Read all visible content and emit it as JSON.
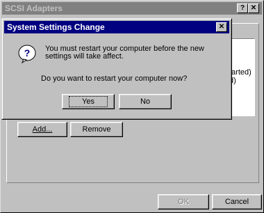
{
  "window": {
    "title": "SCSI Adapters",
    "help_glyph": "?",
    "close_glyph": "✕"
  },
  "list": {
    "partial_line_1": "tarted)",
    "partial_line_2": "d)"
  },
  "buttons": {
    "add": "Add...",
    "remove": "Remove",
    "ok": "OK",
    "cancel": "Cancel"
  },
  "dialog": {
    "title": "System Settings Change",
    "close_glyph": "✕",
    "message_line1": "You must restart your computer before the new",
    "message_line2": "settings will take affect.",
    "question": "Do you want to restart your computer now?",
    "yes": "Yes",
    "no": "No"
  }
}
